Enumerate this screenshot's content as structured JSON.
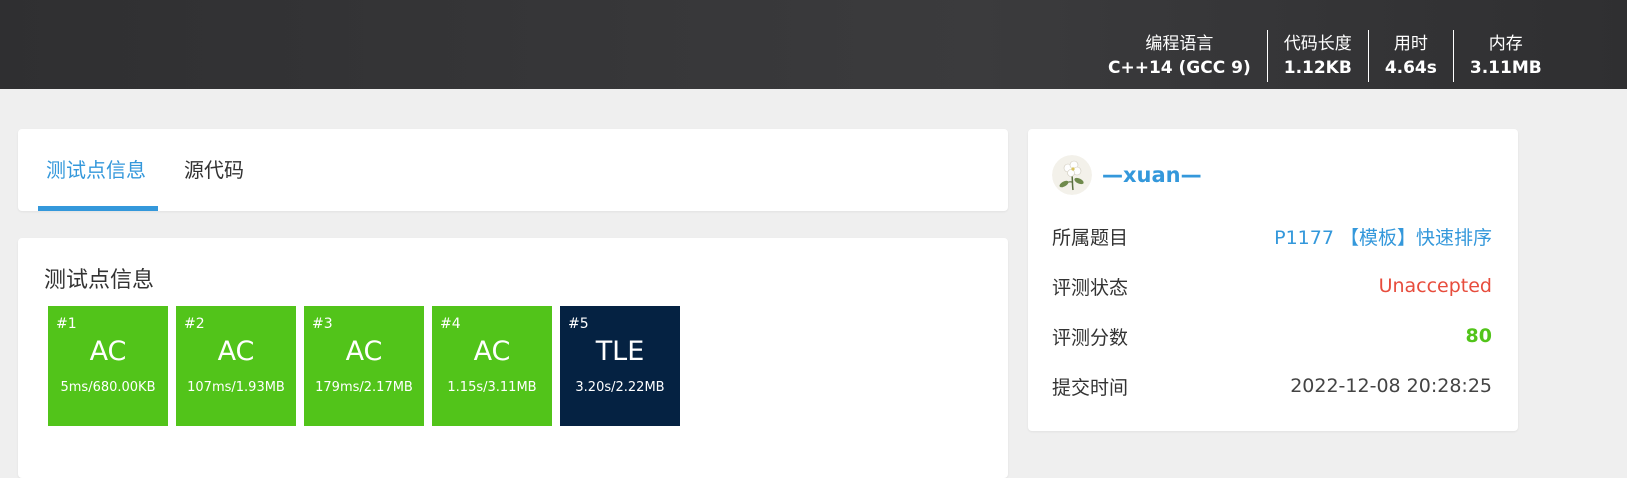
{
  "header": {
    "stats": [
      {
        "label": "编程语言",
        "value": "C++14 (GCC 9)"
      },
      {
        "label": "代码长度",
        "value": "1.12KB"
      },
      {
        "label": "用时",
        "value": "4.64s"
      },
      {
        "label": "内存",
        "value": "3.11MB"
      }
    ]
  },
  "tabs": [
    {
      "label": "测试点信息",
      "active": true
    },
    {
      "label": "源代码",
      "active": false
    }
  ],
  "testcases": {
    "title": "测试点信息",
    "items": [
      {
        "id": "#1",
        "status": "AC",
        "detail": "5ms/680.00KB",
        "color": "#52c41a"
      },
      {
        "id": "#2",
        "status": "AC",
        "detail": "107ms/1.93MB",
        "color": "#52c41a"
      },
      {
        "id": "#3",
        "status": "AC",
        "detail": "179ms/2.17MB",
        "color": "#52c41a"
      },
      {
        "id": "#4",
        "status": "AC",
        "detail": "1.15s/3.11MB",
        "color": "#52c41a"
      },
      {
        "id": "#5",
        "status": "TLE",
        "detail": "3.20s/2.22MB",
        "color": "#052242"
      }
    ]
  },
  "submission": {
    "username": "—xuan—",
    "problem_label": "所属题目",
    "problem_value": "P1177 【模板】快速排序",
    "status_label": "评测状态",
    "status_value": "Unaccepted",
    "score_label": "评测分数",
    "score_value": "80",
    "time_label": "提交时间",
    "time_value": "2022-12-08 20:28:25"
  },
  "colors": {
    "accent": "#3498db",
    "ac": "#52c41a",
    "tle": "#052242",
    "error": "#e74c3c"
  }
}
